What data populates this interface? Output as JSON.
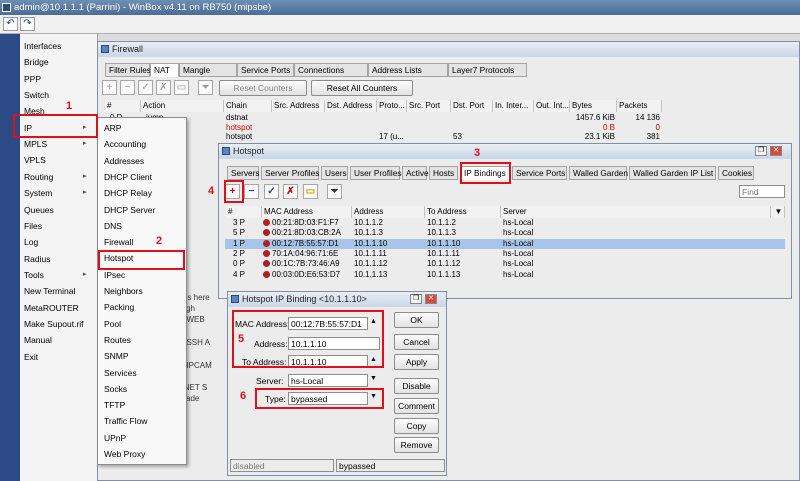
{
  "app": {
    "title": "admin@10.1.1.1 (Parrini) - WinBox v4.11 on RB750 (mipsbe)"
  },
  "sidebar": {
    "items": [
      {
        "label": "Interfaces",
        "sub": false
      },
      {
        "label": "Bridge",
        "sub": false
      },
      {
        "label": "PPP",
        "sub": false
      },
      {
        "label": "Switch",
        "sub": false
      },
      {
        "label": "Mesh",
        "sub": false
      },
      {
        "label": "IP",
        "sub": true
      },
      {
        "label": "MPLS",
        "sub": true
      },
      {
        "label": "VPLS",
        "sub": false
      },
      {
        "label": "Routing",
        "sub": true
      },
      {
        "label": "System",
        "sub": true
      },
      {
        "label": "Queues",
        "sub": false
      },
      {
        "label": "Files",
        "sub": false
      },
      {
        "label": "Log",
        "sub": false
      },
      {
        "label": "Radius",
        "sub": false
      },
      {
        "label": "Tools",
        "sub": true
      },
      {
        "label": "New Terminal",
        "sub": false
      },
      {
        "label": "MetaROUTER",
        "sub": false
      },
      {
        "label": "Make Supout.rif",
        "sub": false
      },
      {
        "label": "Manual",
        "sub": false
      },
      {
        "label": "Exit",
        "sub": false
      }
    ]
  },
  "ip_submenu": {
    "items": [
      "ARP",
      "Accounting",
      "Addresses",
      "DHCP Client",
      "DHCP Relay",
      "DHCP Server",
      "DNS",
      "Firewall",
      "Hotspot",
      "IPsec",
      "Neighbors",
      "Packing",
      "Pool",
      "Routes",
      "SNMP",
      "Services",
      "Socks",
      "TFTP",
      "Traffic Flow",
      "UPnP",
      "Web Proxy"
    ]
  },
  "annotations": [
    "1",
    "2",
    "3",
    "4",
    "5",
    "6"
  ],
  "firewall": {
    "title": "Firewall",
    "tabs": [
      "Filter Rules",
      "NAT",
      "Mangle",
      "Service Ports",
      "Connections",
      "Address Lists",
      "Layer7 Protocols"
    ],
    "reset_counters": "Reset Counters",
    "reset_all_counters": "Reset All Counters",
    "columns": [
      "#",
      "Action",
      "Chain",
      "Src. Address",
      "Dst. Address",
      "Proto...",
      "Src. Port",
      "Dst. Port",
      "In. Inter...",
      "Out. Int...",
      "Bytes",
      "Packets"
    ],
    "rows": [
      {
        "num": "0 D",
        "action": "jump",
        "chain": "dstnat",
        "proto": "",
        "dport": "",
        "bytes": "1457.6 KiB",
        "packets": "14 136",
        "red": false
      },
      {
        "num": "",
        "action": "",
        "chain": "hotspot",
        "proto": "",
        "dport": "",
        "bytes": "0 B",
        "packets": "0",
        "red": true
      },
      {
        "num": "",
        "action": "",
        "chain": "hotspot",
        "proto": "17 (u...",
        "dport": "53",
        "bytes": "23.1 KiB",
        "packets": "381",
        "red": false
      }
    ],
    "bg_fragments": [
      "ns here",
      "gh",
      "O WEB",
      "O SSH A",
      "O IPCAM",
      "RNET S",
      "ade"
    ]
  },
  "hotspot": {
    "title": "Hotspot",
    "tabs": [
      "Servers",
      "Server Profiles",
      "Users",
      "User Profiles",
      "Active",
      "Hosts",
      "IP Bindings",
      "Service Ports",
      "Walled Garden",
      "Walled Garden IP List",
      "Cookies"
    ],
    "find_placeholder": "Find",
    "columns": [
      "#",
      "MAC Address",
      "Address",
      "To Address",
      "Server"
    ],
    "rows": [
      {
        "num": "3 P",
        "mac": "00:21:8D:03:F1:F7",
        "addr": "10.1.1.2",
        "to": "10.1.1.2",
        "server": "hs-Local",
        "selected": false
      },
      {
        "num": "5 P",
        "mac": "00:21:8D:03:CB:2A",
        "addr": "10.1.1.3",
        "to": "10.1.1.3",
        "server": "hs-Local",
        "selected": false
      },
      {
        "num": "1 P",
        "mac": "00:12:7B:55:57:D1",
        "addr": "10.1.1.10",
        "to": "10.1.1.10",
        "server": "hs-Local",
        "selected": true
      },
      {
        "num": "2 P",
        "mac": "70:1A:04:96:71:6E",
        "addr": "10.1.1.11",
        "to": "10.1.1.11",
        "server": "hs-Local",
        "selected": false
      },
      {
        "num": "0 P",
        "mac": "00:1C:7B:73:46:A9",
        "addr": "10.1.1.12",
        "to": "10.1.1.12",
        "server": "hs-Local",
        "selected": false
      },
      {
        "num": "4 P",
        "mac": "00:03:0D:E6:53:D7",
        "addr": "10.1.1.13",
        "to": "10.1.1.13",
        "server": "hs-Local",
        "selected": false
      }
    ]
  },
  "binding": {
    "title": "Hotspot IP Binding <10.1.1.10>",
    "mac_label": "MAC Address:",
    "mac_value": "00:12:7B:55:57:D1",
    "address_label": "Address:",
    "address_value": "10.1.1.10",
    "to_label": "To Address:",
    "to_value": "10.1.1.10",
    "server_label": "Server:",
    "server_value": "hs-Local",
    "type_label": "Type:",
    "type_value": "bypassed",
    "buttons": [
      "OK",
      "Cancel",
      "Apply",
      "Disable",
      "Comment",
      "Copy",
      "Remove"
    ],
    "status_left": "disabled",
    "status_right": "bypassed"
  },
  "colors": {
    "accent_red": "#e0101a",
    "selection": "#a8c4e8",
    "sidebar_strip": "#2b4a86"
  }
}
